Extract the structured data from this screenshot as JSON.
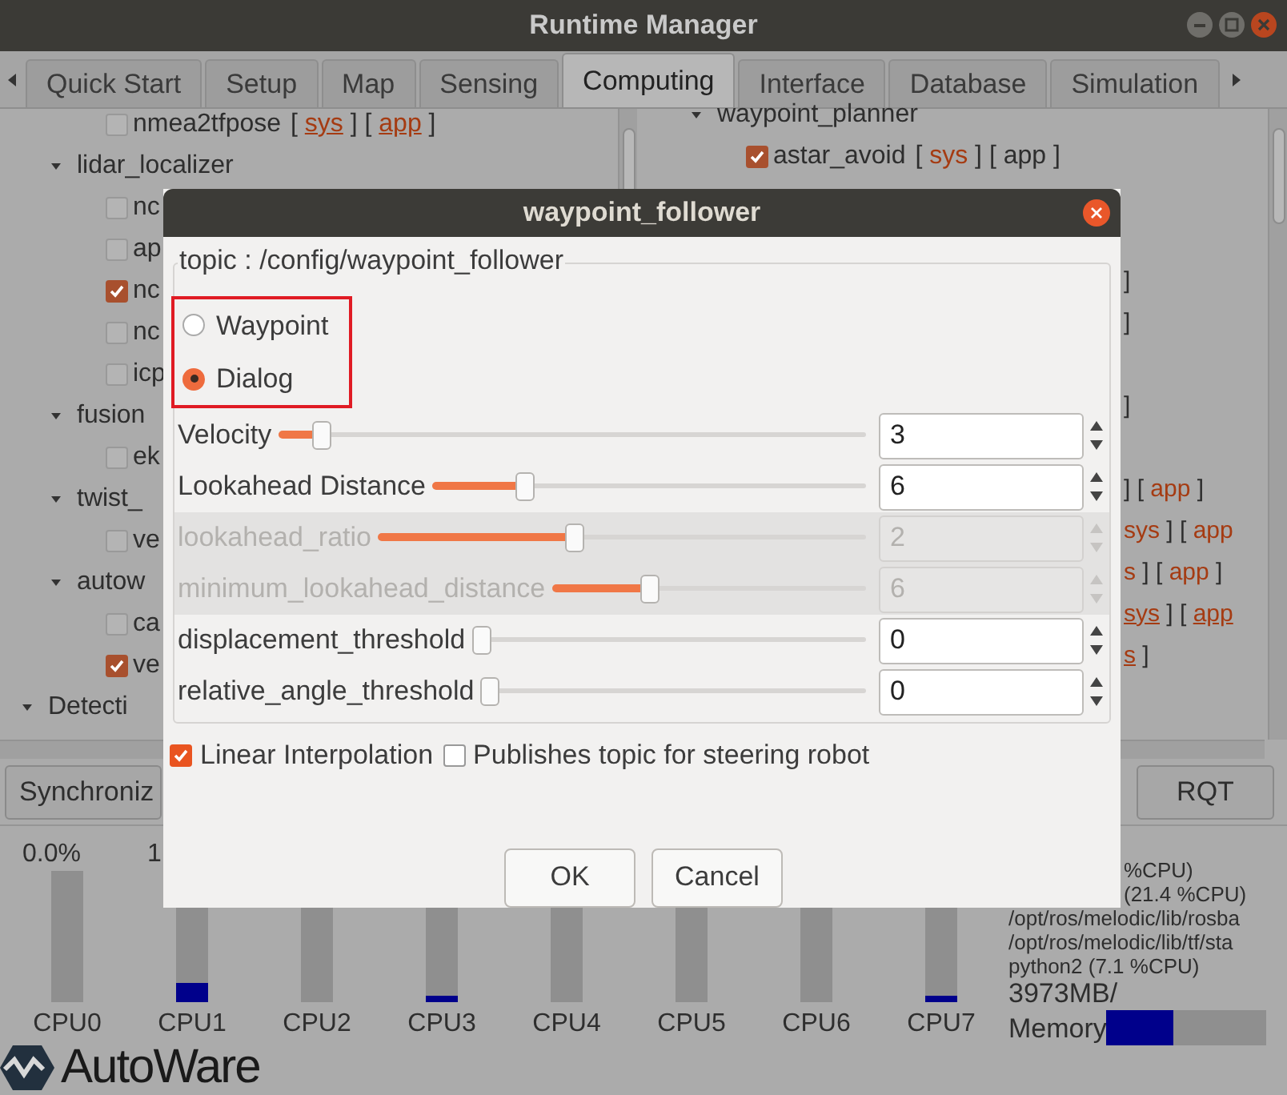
{
  "window": {
    "title": "Runtime Manager"
  },
  "tabs": [
    {
      "label": "Quick Start",
      "selected": false
    },
    {
      "label": "Setup",
      "selected": false
    },
    {
      "label": "Map",
      "selected": false
    },
    {
      "label": "Sensing",
      "selected": false
    },
    {
      "label": "Computing",
      "selected": true
    },
    {
      "label": "Interface",
      "selected": false
    },
    {
      "label": "Database",
      "selected": false
    },
    {
      "label": "Simulation",
      "selected": false
    }
  ],
  "left_tree": [
    {
      "kind": "group",
      "children": [
        {
          "kind": "group",
          "children": [
            {
              "kind": "leaf",
              "label": "nmea2tfpose",
              "checked": false,
              "links": [
                {
                  "kind": "text",
                  "text": "[ "
                },
                {
                  "kind": "link",
                  "text": "sys",
                  "highlighted": true,
                  "underlined": true
                },
                {
                  "kind": "text",
                  "text": " ] [ "
                },
                {
                  "kind": "link",
                  "text": "app",
                  "highlighted": true,
                  "underlined": true
                },
                {
                  "kind": "text",
                  "text": " ]"
                }
              ]
            }
          ]
        },
        {
          "kind": "group",
          "label": "lidar_localizer",
          "expanded": true,
          "children": [
            {
              "kind": "leaf",
              "label": "nc",
              "checked": false
            },
            {
              "kind": "leaf",
              "label": "ap",
              "checked": false
            },
            {
              "kind": "leaf",
              "label": "nc",
              "checked": true
            },
            {
              "kind": "leaf",
              "label": "nc",
              "checked": false
            },
            {
              "kind": "leaf",
              "label": "icp",
              "checked": false
            }
          ]
        },
        {
          "kind": "group",
          "label": "fusion",
          "expanded": true,
          "children": [
            {
              "kind": "leaf",
              "label": "ek",
              "checked": false
            }
          ]
        },
        {
          "kind": "group",
          "label": "twist_",
          "expanded": true,
          "children": [
            {
              "kind": "leaf",
              "label": "ve",
              "checked": false
            }
          ]
        },
        {
          "kind": "group",
          "label": "autow",
          "expanded": true,
          "children": [
            {
              "kind": "leaf",
              "label": "ca",
              "checked": false
            },
            {
              "kind": "leaf",
              "label": "ve",
              "checked": true
            }
          ]
        }
      ]
    },
    {
      "kind": "group",
      "label": "Detecti",
      "expanded": true
    }
  ],
  "right_tree": [
    {
      "kind": "group",
      "children": [
        {
          "kind": "group",
          "label": "waypoint_planner",
          "expanded": true,
          "children": [
            {
              "kind": "leaf",
              "label": "astar_avoid",
              "checked": true,
              "links": [
                {
                  "kind": "text",
                  "text": "[ "
                },
                {
                  "kind": "link",
                  "text": "sys",
                  "highlighted": true,
                  "underlined": false
                },
                {
                  "kind": "text",
                  "text": " ] [ "
                },
                {
                  "kind": "link",
                  "text": "app",
                  "highlighted": false,
                  "underlined": false
                },
                {
                  "kind": "text",
                  "text": " ]"
                }
              ]
            }
          ]
        }
      ]
    }
  ],
  "right_fragments": [
    {
      "kind": "blank"
    },
    {
      "kind": "blank"
    },
    {
      "kind": "row",
      "parts": [
        {
          "kind": "text",
          "text": "]"
        }
      ]
    },
    {
      "kind": "row",
      "parts": [
        {
          "kind": "text",
          "text": "]"
        }
      ]
    },
    {
      "kind": "blank"
    },
    {
      "kind": "row",
      "parts": [
        {
          "kind": "text",
          "text": "]"
        }
      ]
    },
    {
      "kind": "blank"
    },
    {
      "kind": "row",
      "parts": [
        {
          "kind": "text",
          "text": "] [ "
        },
        {
          "kind": "link",
          "text": "app",
          "highlighted": true,
          "underlined": false
        },
        {
          "kind": "text",
          "text": " ]"
        }
      ]
    },
    {
      "kind": "row",
      "parts": [
        {
          "kind": "link",
          "text": "sys",
          "highlighted": true,
          "underlined": false
        },
        {
          "kind": "text",
          "text": " ] [ "
        },
        {
          "kind": "link",
          "text": "app",
          "highlighted": true,
          "underlined": false
        }
      ]
    },
    {
      "kind": "row",
      "parts": [
        {
          "kind": "link",
          "text": "s",
          "highlighted": true,
          "underlined": false
        },
        {
          "kind": "text",
          "text": " ] [ "
        },
        {
          "kind": "link",
          "text": "app",
          "highlighted": true,
          "underlined": false
        },
        {
          "kind": "text",
          "text": " ]"
        }
      ]
    },
    {
      "kind": "row",
      "parts": [
        {
          "kind": "link",
          "text": "sys",
          "highlighted": true,
          "underlined": true
        },
        {
          "kind": "text",
          "text": " ] [ "
        },
        {
          "kind": "link",
          "text": "app",
          "highlighted": true,
          "underlined": true
        }
      ]
    },
    {
      "kind": "row",
      "parts": [
        {
          "kind": "link",
          "text": "s",
          "highlighted": true,
          "underlined": true
        },
        {
          "kind": "text",
          "text": " ]"
        }
      ]
    }
  ],
  "buttons": [
    "Synchroniz",
    "RQT"
  ],
  "cpus": [
    {
      "label": "CPU0",
      "reading": "0.0%",
      "level": 0
    },
    {
      "label": "CPU1",
      "reading": "1",
      "level": 0.15
    },
    {
      "label": "CPU2",
      "level": 0
    },
    {
      "label": "CPU3",
      "level": 0.05
    },
    {
      "label": "CPU4",
      "level": 0
    },
    {
      "label": "CPU5",
      "level": 0
    },
    {
      "label": "CPU6",
      "level": 0
    },
    {
      "label": "CPU7",
      "level": 0.05
    }
  ],
  "process_lines": [
    "%CPU)",
    "(21.4 %CPU)",
    "/opt/ros/melodic/lib/rosba",
    "/opt/ros/melodic/lib/tf/sta",
    "python2 (7.1 %CPU)"
  ],
  "memory": {
    "reading": "3973MB/",
    "label": "Memory",
    "level": 0.42
  },
  "logo": {
    "text": "AutoWare"
  },
  "dialog": {
    "title": "waypoint_follower",
    "group_title": "topic : /config/waypoint_follower",
    "modes": [
      {
        "label": "Waypoint",
        "selected": false
      },
      {
        "label": "Dialog",
        "selected": true
      }
    ],
    "params": [
      {
        "label": "Velocity",
        "level": 0.06,
        "value": "3",
        "disabled": false
      },
      {
        "label": "Lookahead Distance",
        "level": 0.2,
        "value": "6",
        "disabled": false
      },
      {
        "label": "lookahead_ratio",
        "level": 0.4,
        "value": "2",
        "disabled": true
      },
      {
        "label": "minimum_lookahead_distance",
        "level": 0.3,
        "value": "6",
        "disabled": true
      },
      {
        "label": "displacement_threshold",
        "level": 0,
        "value": "0",
        "disabled": false
      },
      {
        "label": "relative_angle_threshold",
        "level": 0,
        "value": "0",
        "disabled": false
      }
    ],
    "options": [
      {
        "label": "Linear Interpolation",
        "checked": true
      },
      {
        "label": "Publishes topic for steering robot",
        "checked": false
      }
    ],
    "buttons": [
      "OK",
      "Cancel"
    ]
  }
}
